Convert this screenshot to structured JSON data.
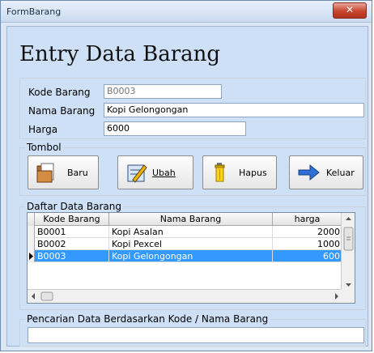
{
  "window": {
    "title": "FormBarang",
    "close_icon": "close-icon"
  },
  "heading": "Entry Data Barang",
  "form": {
    "kode_label": "Kode Barang",
    "kode_value": "B0003",
    "nama_label": "Nama Barang",
    "nama_value": "Kopi Gelongongan",
    "harga_label": "Harga",
    "harga_value": "6000"
  },
  "tombol": {
    "legend": "Tombol",
    "buttons": [
      {
        "label": "Baru",
        "icon": "folder-icon"
      },
      {
        "label": "Ubah",
        "icon": "edit-icon"
      },
      {
        "label": "Hapus",
        "icon": "trash-icon"
      },
      {
        "label": "Keluar",
        "icon": "arrow-right-icon"
      }
    ]
  },
  "daftar": {
    "legend": "Daftar Data Barang",
    "columns": [
      "Kode Barang",
      "Nama Barang",
      "harga"
    ],
    "rows": [
      [
        "B0001",
        "Kopi Asalan",
        "2000"
      ],
      [
        "B0002",
        "Kopi Pexcel",
        "1000"
      ],
      [
        "B0003",
        "Kopi Gelongongan",
        "600"
      ]
    ],
    "selected_row": 2
  },
  "search": {
    "legend": "Pencarian Data Berdasarkan Kode / Nama Barang",
    "value": ""
  }
}
